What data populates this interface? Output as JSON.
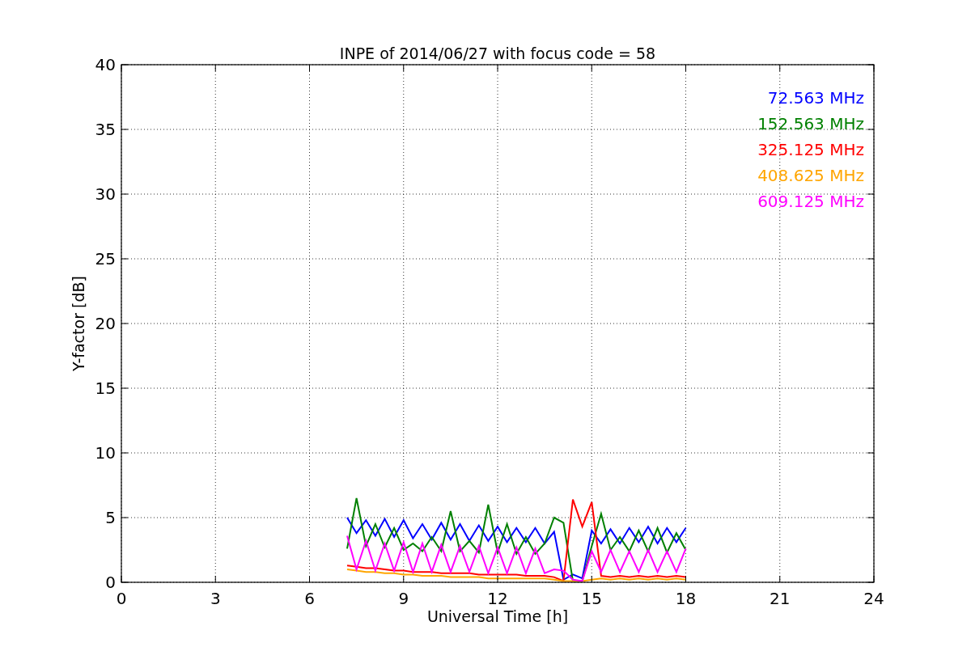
{
  "chart_data": {
    "type": "line",
    "title": "INPE of 2014/06/27 with focus code = 58",
    "xlabel": "Universal Time [h]",
    "ylabel": "Y-factor [dB]",
    "grid": true,
    "xlim": [
      0,
      24
    ],
    "ylim": [
      0,
      40
    ],
    "xticks": [
      0,
      3,
      6,
      9,
      12,
      15,
      18,
      21,
      24
    ],
    "yticks": [
      0,
      5,
      10,
      15,
      20,
      25,
      30,
      35,
      40
    ],
    "x": [
      7.2,
      7.5,
      7.8,
      8.1,
      8.4,
      8.7,
      9.0,
      9.3,
      9.6,
      9.9,
      10.2,
      10.5,
      10.8,
      11.1,
      11.4,
      11.7,
      12.0,
      12.3,
      12.6,
      12.9,
      13.2,
      13.5,
      13.8,
      14.1,
      14.4,
      14.7,
      15.0,
      15.3,
      15.6,
      15.9,
      16.2,
      16.5,
      16.8,
      17.1,
      17.4,
      17.7,
      18.0
    ],
    "series": [
      {
        "name": "72.563 MHz",
        "color": "#0000ff",
        "values": [
          5.0,
          3.8,
          4.8,
          3.6,
          4.9,
          3.5,
          4.8,
          3.4,
          4.5,
          3.3,
          4.6,
          3.3,
          4.5,
          3.2,
          4.4,
          3.2,
          4.3,
          3.1,
          4.2,
          3.1,
          4.2,
          3.0,
          3.9,
          0.2,
          0.6,
          0.3,
          4.0,
          3.0,
          4.1,
          3.0,
          4.2,
          3.1,
          4.3,
          3.0,
          4.2,
          3.1,
          4.2
        ]
      },
      {
        "name": "152.563 MHz",
        "color": "#008000",
        "values": [
          2.6,
          6.5,
          2.8,
          4.5,
          2.7,
          4.2,
          2.5,
          3.0,
          2.4,
          3.5,
          2.4,
          5.5,
          2.4,
          3.2,
          2.3,
          6.0,
          2.3,
          4.5,
          2.2,
          3.5,
          2.2,
          3.0,
          5.0,
          4.6,
          0.1,
          0.1,
          2.8,
          5.3,
          2.5,
          3.5,
          2.4,
          4.0,
          2.4,
          4.2,
          2.3,
          3.8,
          2.5
        ]
      },
      {
        "name": "325.125 MHz",
        "color": "#ff0000",
        "values": [
          1.3,
          1.2,
          1.1,
          1.1,
          1.0,
          0.9,
          0.9,
          0.8,
          0.8,
          0.8,
          0.7,
          0.7,
          0.7,
          0.7,
          0.6,
          0.6,
          0.6,
          0.6,
          0.6,
          0.5,
          0.5,
          0.5,
          0.4,
          0.1,
          6.4,
          4.3,
          6.2,
          0.5,
          0.4,
          0.5,
          0.4,
          0.5,
          0.4,
          0.5,
          0.4,
          0.5,
          0.4
        ]
      },
      {
        "name": "408.625 MHz",
        "color": "#ffa500",
        "values": [
          1.0,
          0.9,
          0.8,
          0.8,
          0.7,
          0.7,
          0.6,
          0.6,
          0.5,
          0.5,
          0.5,
          0.4,
          0.4,
          0.4,
          0.4,
          0.3,
          0.3,
          0.3,
          0.3,
          0.3,
          0.3,
          0.3,
          0.2,
          0.1,
          0.1,
          0.1,
          0.2,
          0.3,
          0.2,
          0.3,
          0.2,
          0.3,
          0.2,
          0.3,
          0.2,
          0.3,
          0.2
        ]
      },
      {
        "name": "609.125 MHz",
        "color": "#ff00ff",
        "values": [
          3.6,
          1.0,
          3.2,
          0.9,
          3.0,
          0.9,
          3.1,
          0.8,
          3.0,
          0.8,
          2.9,
          0.8,
          2.8,
          0.8,
          2.8,
          0.7,
          2.7,
          0.7,
          2.7,
          0.7,
          2.6,
          0.7,
          1.0,
          0.9,
          0.2,
          0.1,
          2.4,
          0.8,
          2.5,
          0.8,
          2.4,
          0.8,
          2.5,
          0.8,
          2.4,
          0.8,
          2.6
        ]
      }
    ]
  }
}
